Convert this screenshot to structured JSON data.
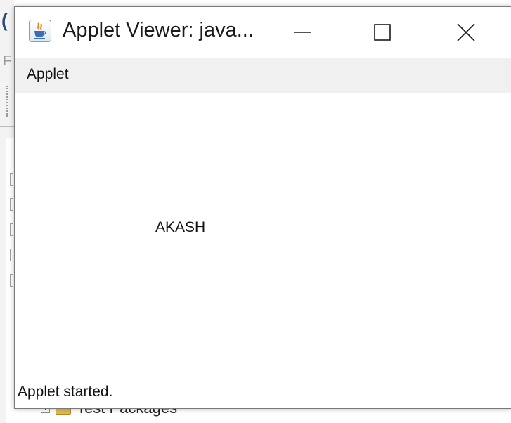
{
  "background_ide": {
    "fragment_big": "(",
    "fragment_small": "F",
    "tree": {
      "expander": "+",
      "label": "Test Packages"
    }
  },
  "window": {
    "title": "Applet Viewer: java...",
    "icon": "java-cup-icon",
    "controls": {
      "minimize": "minimize-icon",
      "maximize": "maximize-icon",
      "close": "close-icon"
    },
    "menu": {
      "items": [
        {
          "label": "Applet"
        }
      ]
    },
    "content": {
      "text": "AKASH"
    },
    "status": "Applet started."
  },
  "colors": {
    "java_cup_orange": "#e8871e",
    "java_cup_blue": "#3b6db3",
    "menubar_bg": "#f0f0f0"
  }
}
